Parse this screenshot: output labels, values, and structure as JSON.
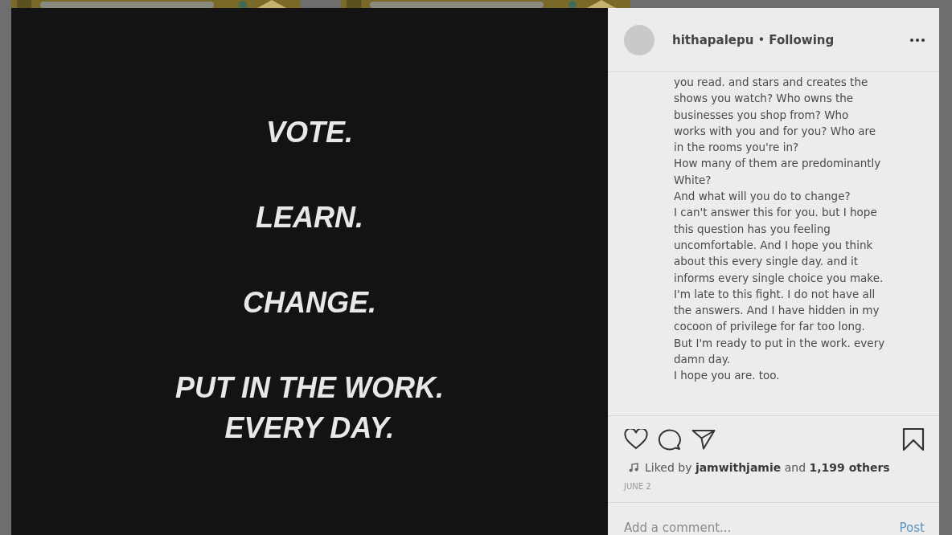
{
  "post_image": {
    "slogan": [
      {
        "lines": [
          "VOTE."
        ]
      },
      {
        "lines": [
          "LEARN."
        ]
      },
      {
        "lines": [
          "CHANGE."
        ]
      },
      {
        "lines": [
          "PUT IN THE WORK.",
          "EVERY DAY."
        ]
      }
    ]
  },
  "header": {
    "username": "hithapalepu",
    "separator": "•",
    "follow_status": "Following"
  },
  "caption_lines": [
    "you read. and stars and creates the",
    "shows you watch? Who owns the",
    "businesses you shop from? Who",
    "works with you and for you? Who are",
    "in the rooms you're in?",
    "How many of them are predominantly",
    "White?",
    "And what will you do to change?",
    "I can't answer this for you. but I hope",
    "this question has you feeling",
    "uncomfortable. And I hope you think",
    "about this every single day. and it",
    "informs every single choice you make.",
    "I'm late to this fight. I do not have all",
    "the answers. And I have hidden in my",
    "cocoon of privilege for far too long.",
    "But I'm ready to put in the work. every",
    "damn day.",
    "I hope you are. too."
  ],
  "likes": "Liked by **jamwithjamie** and **1,199 others**",
  "date": "JUNE 2",
  "comment": {
    "placeholder": "Add a comment...",
    "post_button": "Post"
  }
}
